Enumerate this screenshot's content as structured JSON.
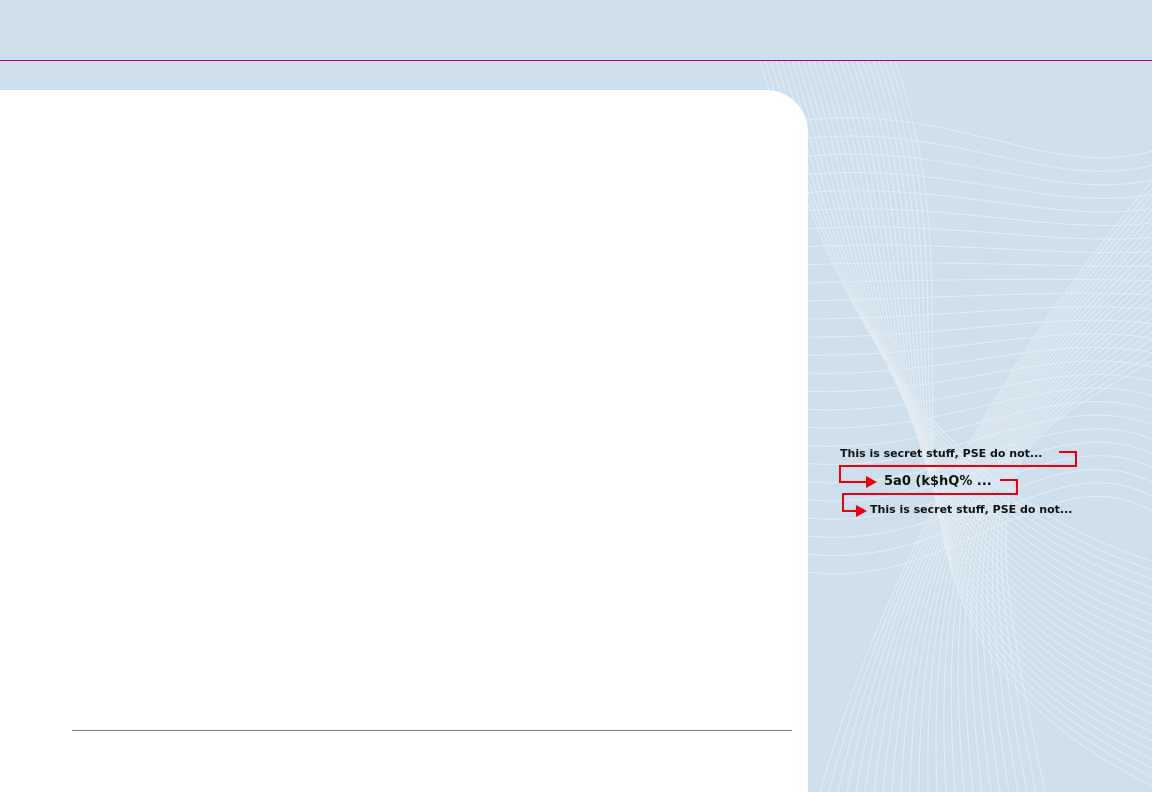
{
  "diagram": {
    "step1_text": "This is secret stuff, PSE do not...",
    "step2_text": "5a0 (k$hQ% ...",
    "step3_text": "This is secret stuff, PSE do not...",
    "arrow_color": "#e8000a"
  },
  "colors": {
    "background": "#cddfec",
    "accent_line": "#b2007a",
    "panel": "#ffffff"
  }
}
